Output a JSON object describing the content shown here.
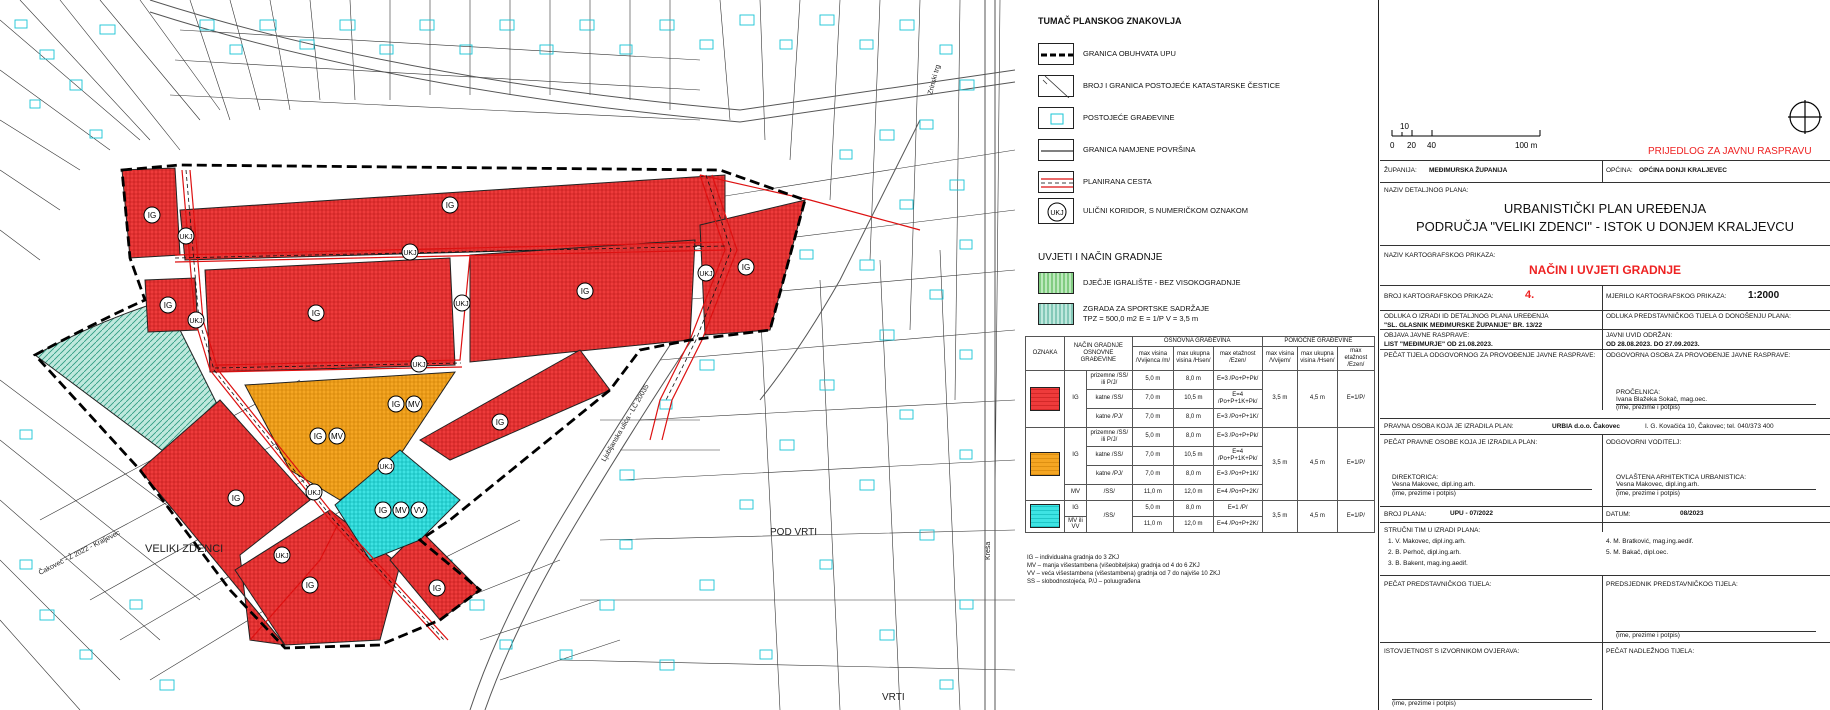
{
  "map": {
    "place_labels": [
      "VELIKI ZDENCI",
      "POD VRTI",
      "VRTI"
    ],
    "road_labels": [
      "Ljubljanska ulica - LC 20035",
      "Zrinski trg",
      "Čakovec - Ž 2022 - Kraljevec",
      "Kreša"
    ],
    "zone_labels": {
      "ig": "IG",
      "mv": "MV",
      "vv": "VV",
      "ukj": "UKJ"
    }
  },
  "legend": {
    "title": "TUMAČ PLANSKOG ZNAKOVLJA",
    "items": [
      {
        "label": "GRANICA OBUHVATA UPU"
      },
      {
        "label": "BROJ I GRANICA POSTOJEĆE KATASTARSKE ČESTICE"
      },
      {
        "label": "POSTOJEĆE GRAĐEVINE"
      },
      {
        "label": "GRANICA NAMJENE POVRŠINA"
      },
      {
        "label": "PLANIRANA CESTA"
      },
      {
        "label": "ULIČNI KORIDOR, S NUMERIČKOM OZNAKOM"
      }
    ],
    "ukj_symbol": "UKJ",
    "section2_title": "UVJETI I NAČIN GRADNJE",
    "items2": [
      {
        "label": "DJEČJE IGRALIŠTE - BEZ VISOKOGRADNJE"
      },
      {
        "label": "ZGRADA ZA SPORTSKE SADRŽAJE",
        "sub": "TPZ = 500,0 m2    E = 1/P         V = 3,5 m"
      }
    ],
    "table": {
      "headers": [
        "OZNAKA",
        "NAČIN GRADNJE OSNOVNE GRAĐEVINE",
        "OSNOVNA GRAĐEVINA",
        "POMOĆNE GRAĐEVINE"
      ],
      "subheaders": [
        "max visina /Vvijenca /m/",
        "max ukupna visina /Hsen/",
        "max etažnost /Ezen/",
        "max visina /Vvijem/",
        "max ukupna visina /Hsen/",
        "max etažnost /Ezen/"
      ],
      "groups": [
        {
          "code": "IG",
          "rows": [
            [
              "prizemne /SS/ ili P/J/",
              "5,0 m",
              "8,0 m",
              "E=3 /Po+P+Pk/"
            ],
            [
              "katne /SS/",
              "7,0 m",
              "10,5 m",
              "E=4 /Po+P+1K+Pk/"
            ],
            [
              "katne /PJ/",
              "7,0 m",
              "8,0 m",
              "E=3 /Po+P+1K/"
            ]
          ],
          "aux": [
            "3,5 m",
            "4,5 m",
            "E=1/P/"
          ]
        },
        {
          "code": "IG",
          "rows": [
            [
              "prizemne /SS/ ili P/J/",
              "5,0 m",
              "8,0 m",
              "E=3 /Po+P+Pk/"
            ],
            [
              "katne /SS/",
              "7,0 m",
              "10,5 m",
              "E=4 /Po+P+1K+Pk/"
            ],
            [
              "katne /PJ/",
              "7,0 m",
              "8,0 m",
              "E=3 /Po+P+1K/"
            ]
          ],
          "aux": [
            "3,5 m",
            "4,5 m",
            "E=1/P/"
          ]
        },
        {
          "code": "MV",
          "rows": [
            [
              "/SS/",
              "11,0 m",
              "12,0 m",
              "E=4 /Po+P+2K/"
            ]
          ]
        },
        {
          "code": "IG",
          "rows": [
            [
              "/SS/",
              "5,0 m",
              "8,0 m",
              "E=1 /P/"
            ]
          ],
          "aux": [
            "3,5 m",
            "4,5 m",
            "E=1/P/"
          ]
        },
        {
          "code": "MV ili VV",
          "rows": [
            [
              "/SS/",
              "11,0 m",
              "12,0 m",
              "E=4 /Po+P+2K/"
            ]
          ]
        }
      ],
      "footnotes": [
        "IG – individualna gradnja do 3 ZKJ",
        "MV – manja višestambena (višeobiteljska) gradnja od 4 do 6 ZKJ",
        "VV – veća višestambena (višestambena) gradnja od 7 do najviše 10 ZKJ",
        "SS – slobodnostojeća, P/J – poluugrađena"
      ]
    }
  },
  "titleblock": {
    "scale_labels": [
      "10",
      "0",
      "20",
      "40",
      "100 m"
    ],
    "stamp": "PRIJEDLOG ZA JAVNU RASPRAVU",
    "zupanija_label": "ŽUPANIJA:",
    "zupanija": "MEĐIMURSKA ŽUPANIJA",
    "opcina_label": "OPĆINA:",
    "opcina": "OPĆINA DONJI KRALJEVEC",
    "plan_name_label": "NAZIV DETALJNOG PLANA:",
    "plan_name_1": "URBANISTIČKI PLAN UREĐENJA",
    "plan_name_2": "PODRUČJA \"VELIKI ZDENCI\" - ISTOK U DONJEM KRALJEVCU",
    "map_name_label": "NAZIV KARTOGRAFSKOG PRIKAZA:",
    "map_name": "NAČIN I UVJETI GRADNJE",
    "map_no_label": "BROJ KARTOGRAFSKOG PRIKAZA:",
    "map_no": "4.",
    "scale_label": "MJERILO KARTOGRAFSKOG PRIKAZA:",
    "scale": "1:2000",
    "decision_label": "ODLUKA O IZRADI ID DETALJNOG PLANA UREĐENJA",
    "decision": "\"SL. GLASNIK MEĐIMURSKE ŽUPANIJE\" BR. 13/22",
    "decision2_label": "ODLUKA PREDSTAVNIČKOG TIJELA O DONOŠENJU PLANA:",
    "public_label": "OBJAVA JAVNE RASPRAVE:",
    "public": "LIST \"MEĐIMURJE\" OD 21.08.2023.",
    "display_label": "JAVNI UVID ODRŽAN:",
    "display": "OD 28.08.2023. DO 27.09.2023.",
    "seal_label": "PEČAT TIJELA ODGOVORNOG ZA PROVOĐENJE JAVNE RASPRAVE:",
    "resp_label": "ODGOVORNA OSOBA ZA PROVOĐENJE JAVNE RASPRAVE:",
    "procelnica": "PROČELNICA:",
    "procelnica_name": "Ivana Blažeka Sokač, mag.oec.",
    "sign_hint": "(ime, prezime i potpis)",
    "maker_label": "PRAVNA OSOBA KOJA JE IZRADILA PLAN:",
    "maker": "URBIA d.o.o. Čakovec",
    "maker_addr": "I. G. Kovačića 10, Čakovec; tel. 040/373 400",
    "maker_seal_label": "PEČAT PRAVNE OSOBE KOJA JE IZRADILA PLAN:",
    "leader_label": "ODGOVORNI VODITELJ:",
    "direktorica": "DIREKTORICA:",
    "direktorica_name": "Vesna Makovec, dipl.ing.arh.",
    "architect_title": "OVLAŠTENA ARHITEKTICA URBANISTICA:",
    "architect_name": "Vesna Makovec, dipl.ing.arh.",
    "plan_no_label": "BROJ PLANA:",
    "plan_no": "UPU - 07/2022",
    "date_label": "DATUM:",
    "date": "08/2023",
    "team_label": "STRUČNI TIM U IZRADI PLANA:",
    "team": [
      "1.   V. Makovec, dipl.ing.arh.",
      "2.   B. Perhoč, dipl.ing.arh.",
      "3.   B. Bakent, mag.ing.aedif.",
      "4.   M. Bratković, mag.ing.aedif.",
      "5.   M. Bakač, dipl.oec."
    ],
    "council_seal_label": "PEČAT PREDSTAVNIČKOG TIJELA:",
    "council_pres_label": "PREDSJEDNIK PREDSTAVNIČKOG TIJELA:",
    "identity_label": "ISTOVJETNOST S IZVORNIKOM OVJERAVA:",
    "super_seal_label": "PEČAT NADLEŽNOG TIJELA:"
  }
}
